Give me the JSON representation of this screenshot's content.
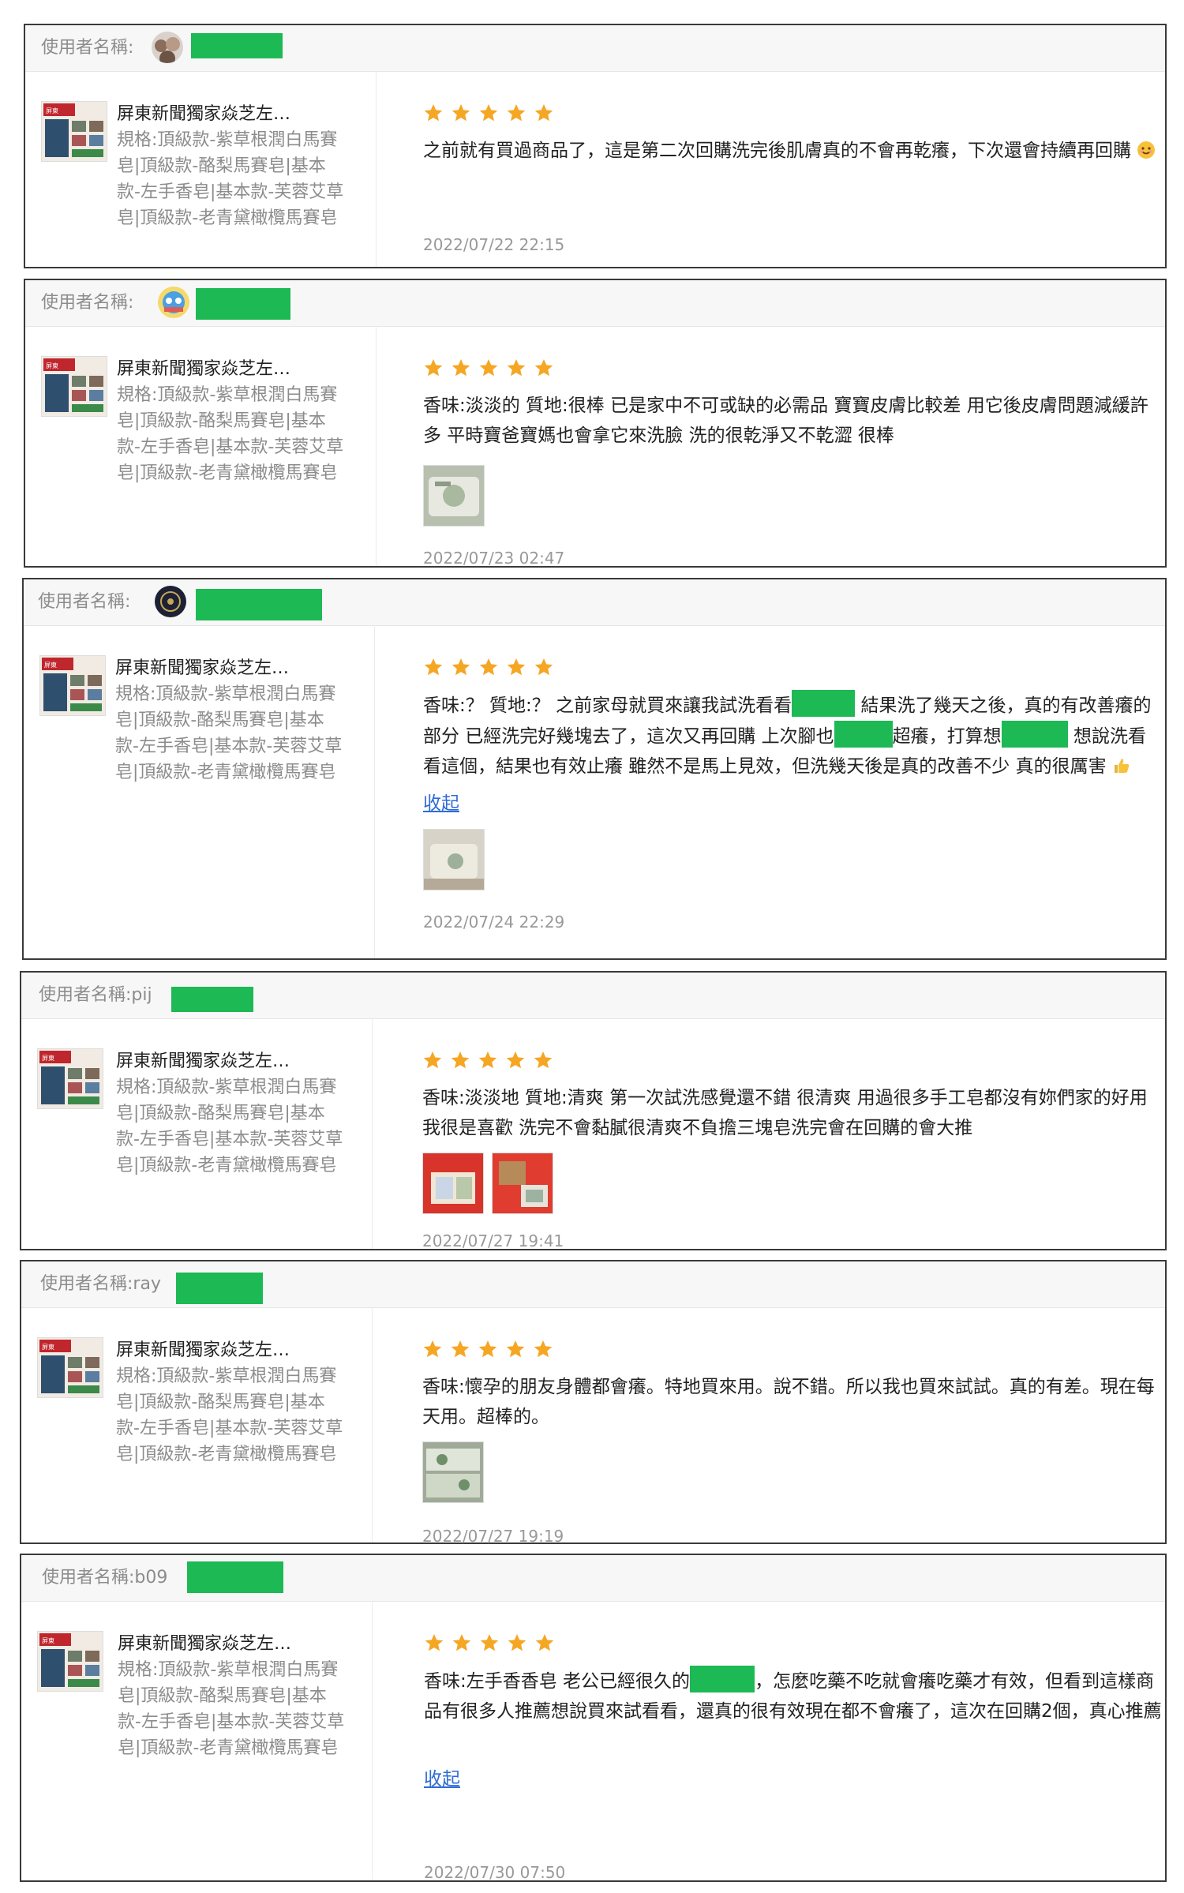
{
  "colors": {
    "redaction": "#1db954",
    "star": "#f5a623",
    "link": "#2e6bd6"
  },
  "reviews": [
    {
      "username_label": "使用者名稱:",
      "username_visible": "",
      "product_name": "屏東新聞獨家焱芝左…",
      "product_spec": "規格:頂級款-紫草根潤白馬賽皂|頂級款-酪梨馬賽皂|基本款-左手香皂|基本款-芙蓉艾草皂|頂級款-老青黛橄欖馬賽皂",
      "rating": 5,
      "comment_parts": [
        "之前就有買過商品了，這是第二次回購洗完後肌膚真的不會再乾癢，下次還會持續再回購"
      ],
      "emoji": "smile-emoji",
      "photos": 0,
      "collapse_label": "",
      "date": "2022/07/22 22:15"
    },
    {
      "username_label": "使用者名稱:",
      "username_visible": "",
      "product_name": "屏東新聞獨家焱芝左…",
      "product_spec": "規格:頂級款-紫草根潤白馬賽皂|頂級款-酪梨馬賽皂|基本款-左手香皂|基本款-芙蓉艾草皂|頂級款-老青黛橄欖馬賽皂",
      "rating": 5,
      "comment_parts": [
        "香味:淡淡的 質地:很棒 已是家中不可或缺的必需品 寶寶皮膚比較差 用它後皮膚問題減緩許多 平時寶爸寶媽也會拿它來洗臉 洗的很乾淨又不乾澀 很棒"
      ],
      "photos": 1,
      "collapse_label": "",
      "date": "2022/07/23 02:47"
    },
    {
      "username_label": "使用者名稱:",
      "username_visible": "",
      "product_name": "屏東新聞獨家焱芝左…",
      "product_spec": "規格:頂級款-紫草根潤白馬賽皂|頂級款-酪梨馬賽皂|基本款-左手香皂|基本款-芙蓉艾草皂|頂級款-老青黛橄欖馬賽皂",
      "rating": 5,
      "comment_parts": [
        "香味:？ 質地:？ 之前家母就買來讓我試洗看看",
        "結果洗了幾天之後，真的有改善癢的部分 已經洗完好幾塊去了，這次又再回購 上次腳也",
        "超癢，打算想",
        "想說洗看看這個，結果也有效止癢 雖然不是馬上見效，但洗幾天後是真的改善不少 真的很厲害"
      ],
      "emoji": "thumbs-up-emoji",
      "photos": 1,
      "collapse_label": "收起",
      "date": "2022/07/24 22:29"
    },
    {
      "username_label": "使用者名稱:",
      "username_visible": "pij",
      "product_name": "屏東新聞獨家焱芝左…",
      "product_spec": "規格:頂級款-紫草根潤白馬賽皂|頂級款-酪梨馬賽皂|基本款-左手香皂|基本款-芙蓉艾草皂|頂級款-老青黛橄欖馬賽皂",
      "rating": 5,
      "comment_parts": [
        "香味:淡淡地 質地:清爽 第一次試洗感覺還不錯 很清爽 用過很多手工皂都沒有妳們家的好用 我很是喜歡 洗完不會黏膩很清爽不負擔三塊皂洗完會在回購的會大推"
      ],
      "photos": 2,
      "collapse_label": "",
      "date": "2022/07/27 19:41"
    },
    {
      "username_label": "使用者名稱:",
      "username_visible": "ray",
      "product_name": "屏東新聞獨家焱芝左…",
      "product_spec": "規格:頂級款-紫草根潤白馬賽皂|頂級款-酪梨馬賽皂|基本款-左手香皂|基本款-芙蓉艾草皂|頂級款-老青黛橄欖馬賽皂",
      "rating": 5,
      "comment_parts": [
        "香味:懷孕的朋友身體都會癢。特地買來用。說不錯。所以我也買來試試。真的有差。現在每天用。超棒的。"
      ],
      "photos": 1,
      "collapse_label": "",
      "date": "2022/07/27 19:19"
    },
    {
      "username_label": "使用者名稱:",
      "username_visible": "b09",
      "product_name": "屏東新聞獨家焱芝左…",
      "product_spec": "規格:頂級款-紫草根潤白馬賽皂|頂級款-酪梨馬賽皂|基本款-左手香皂|基本款-芙蓉艾草皂|頂級款-老青黛橄欖馬賽皂",
      "rating": 5,
      "comment_parts": [
        "香味:左手香香皂 老公已經很久的",
        "，怎麼吃藥不吃就會癢吃藥才有效，但看到這樣商品有很多人推薦想說買來試看看，還真的很有效現在都不會癢了，這次在回購2個，真心推薦"
      ],
      "photos": 0,
      "collapse_label": "收起",
      "date": "2022/07/30 07:50"
    }
  ]
}
